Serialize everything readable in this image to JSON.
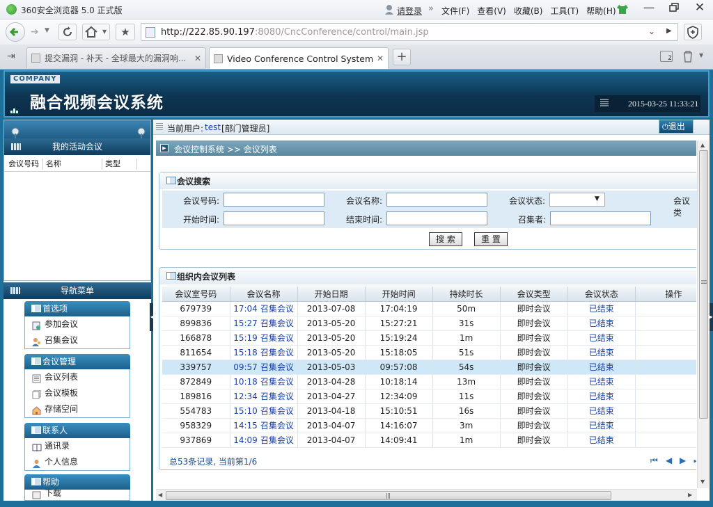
{
  "browser": {
    "title": "360安全浏览器 5.0 正式版",
    "login": "请登录",
    "menus": [
      "文件(F)",
      "查看(V)",
      "收藏(B)",
      "工具(T)",
      "帮助(H)"
    ],
    "url_host": "http://222.85.90.197",
    "url_rest": ":8080/CncConference/control/main.jsp",
    "tabs": [
      {
        "label": "提交漏洞 - 补天 - 全球最大的漏洞响...",
        "active": false
      },
      {
        "label": "Video Conference Control System",
        "active": true
      }
    ],
    "tab_count": "2"
  },
  "banner": {
    "company": "COMPANY",
    "title": "融合视频会议系统",
    "datetime": "2015-03-25 11:33:21"
  },
  "userbar": {
    "user_prefix": "当前用户:",
    "user_name": "test",
    "user_role": "[部门管理员]",
    "logout": "退出"
  },
  "left": {
    "active_meetings_title": "我的活动会议",
    "active_columns": [
      "会议号码",
      "名称",
      "类型"
    ],
    "nav_title": "导航菜单",
    "groups": [
      {
        "title": "首选项",
        "items": [
          {
            "label": "参加会议",
            "icon": "join-icon"
          },
          {
            "label": "召集会议",
            "icon": "convene-icon"
          }
        ]
      },
      {
        "title": "会议管理",
        "items": [
          {
            "label": "会议列表",
            "icon": "list-icon"
          },
          {
            "label": "会议模板",
            "icon": "template-icon"
          },
          {
            "label": "存储空间",
            "icon": "storage-icon"
          }
        ]
      },
      {
        "title": "联系人",
        "items": [
          {
            "label": "通讯录",
            "icon": "addressbook-icon"
          },
          {
            "label": "个人信息",
            "icon": "person-icon"
          }
        ]
      },
      {
        "title": "帮助",
        "items": [
          {
            "label": "下载",
            "icon": "download-icon"
          }
        ]
      }
    ]
  },
  "main": {
    "breadcrumb": "会议控制系统 >> 会议列表",
    "search": {
      "title": "会议搜索",
      "fields": {
        "number_label": "会议号码:",
        "name_label": "会议名称:",
        "status_label": "会议状态:",
        "type_label": "会议类",
        "start_label": "开始时间:",
        "end_label": "结束时间:",
        "convener_label": "召集者:"
      },
      "search_button": "搜 索",
      "reset_button": "重 置"
    },
    "list": {
      "title": "组织内会议列表",
      "columns": [
        "会议室号码",
        "会议名称",
        "开始日期",
        "开始时间",
        "持续时长",
        "会议类型",
        "会议状态",
        "操作"
      ],
      "rows": [
        {
          "room": "679739",
          "time": "17:04",
          "name": "召集会议",
          "date": "2013-07-08",
          "start": "17:04:19",
          "dur": "50m",
          "type": "即时会议",
          "status": "已结束",
          "hl": false
        },
        {
          "room": "899836",
          "time": "15:27",
          "name": "召集会议",
          "date": "2013-05-20",
          "start": "15:27:21",
          "dur": "31s",
          "type": "即时会议",
          "status": "已结束",
          "hl": false
        },
        {
          "room": "166878",
          "time": "15:19",
          "name": "召集会议",
          "date": "2013-05-20",
          "start": "15:19:24",
          "dur": "1m",
          "type": "即时会议",
          "status": "已结束",
          "hl": false
        },
        {
          "room": "811654",
          "time": "15:18",
          "name": "召集会议",
          "date": "2013-05-20",
          "start": "15:18:05",
          "dur": "51s",
          "type": "即时会议",
          "status": "已结束",
          "hl": false
        },
        {
          "room": "339757",
          "time": "09:57",
          "name": "召集会议",
          "date": "2013-05-03",
          "start": "09:57:08",
          "dur": "54s",
          "type": "即时会议",
          "status": "已结束",
          "hl": true
        },
        {
          "room": "872849",
          "time": "10:18",
          "name": "召集会议",
          "date": "2013-04-28",
          "start": "10:18:14",
          "dur": "13m",
          "type": "即时会议",
          "status": "已结束",
          "hl": false
        },
        {
          "room": "189816",
          "time": "12:34",
          "name": "召集会议",
          "date": "2013-04-27",
          "start": "12:34:09",
          "dur": "11s",
          "type": "即时会议",
          "status": "已结束",
          "hl": false
        },
        {
          "room": "554783",
          "time": "15:10",
          "name": "召集会议",
          "date": "2013-04-18",
          "start": "15:10:51",
          "dur": "16s",
          "type": "即时会议",
          "status": "已结束",
          "hl": false
        },
        {
          "room": "958329",
          "time": "14:15",
          "name": "召集会议",
          "date": "2013-04-07",
          "start": "14:16:07",
          "dur": "3m",
          "type": "即时会议",
          "status": "已结束",
          "hl": false
        },
        {
          "room": "937869",
          "time": "14:09",
          "name": "召集会议",
          "date": "2013-04-07",
          "start": "14:09:41",
          "dur": "1m",
          "type": "即时会议",
          "status": "已结束",
          "hl": false
        }
      ],
      "summary": "总53条记录, 当前第1/6"
    }
  },
  "colors": {
    "accent": "#1e6f99",
    "link": "#1a3fa8",
    "highlight_row": "#cfe8f7"
  }
}
